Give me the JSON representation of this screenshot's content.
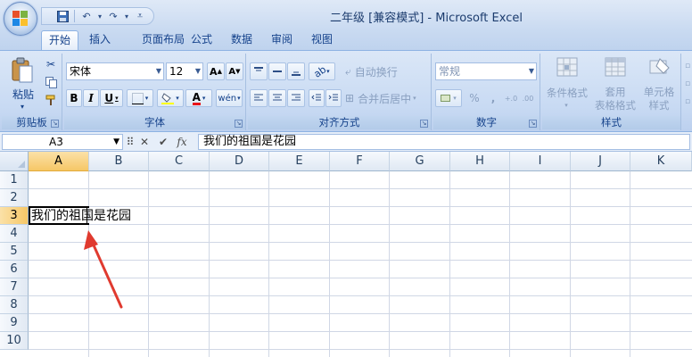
{
  "window": {
    "title": "二年级  [兼容模式] - Microsoft Excel"
  },
  "tabs": [
    {
      "label": "开始",
      "active": true
    },
    {
      "label": "插入"
    },
    {
      "label": "页面布局"
    },
    {
      "label": "公式"
    },
    {
      "label": "数据"
    },
    {
      "label": "审阅"
    },
    {
      "label": "视图"
    }
  ],
  "ribbon": {
    "clipboard": {
      "label": "剪贴板",
      "paste_label": "粘贴"
    },
    "font": {
      "label": "字体",
      "font_name": "宋体",
      "font_size": "12",
      "bold": "B",
      "italic": "I",
      "underline": "U",
      "phonetic": "wén"
    },
    "alignment": {
      "label": "对齐方式",
      "wrap_text": "自动换行",
      "merge_center": "合并后居中"
    },
    "number": {
      "label": "数字",
      "format": "常规",
      "percent": "%",
      "comma": ",",
      "inc_decimal": "+.0",
      "dec_decimal": ".00"
    },
    "styles": {
      "label": "样式",
      "conditional": [
        "条件格式"
      ],
      "table_format": [
        "套用",
        "表格格式"
      ],
      "cell_styles": [
        "单元格",
        "样式"
      ]
    }
  },
  "formula_bar": {
    "name_box": "A3",
    "fx": "fx",
    "content": "我们的祖国是花园"
  },
  "sheet": {
    "columns": [
      "A",
      "B",
      "C",
      "D",
      "E",
      "F",
      "G",
      "H",
      "I",
      "J",
      "K"
    ],
    "rows": [
      "1",
      "2",
      "3",
      "4",
      "5",
      "6",
      "7",
      "8",
      "9",
      "10"
    ],
    "selected_column": "A",
    "selected_row": "3",
    "cell_a3": "我们的祖国是花园"
  },
  "colors": {
    "arrow": "#e03a2f",
    "accent": "#15428b",
    "selection": "#f6c766"
  }
}
